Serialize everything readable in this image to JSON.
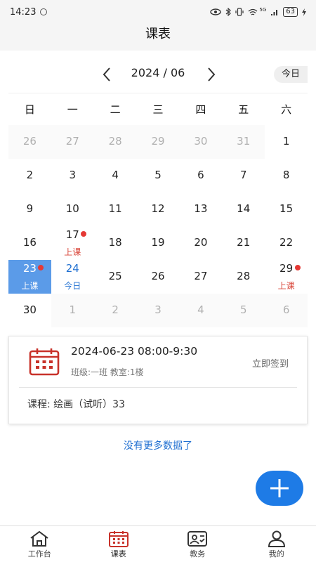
{
  "status_bar": {
    "time": "14:23",
    "network": "5G",
    "battery": "63"
  },
  "header": {
    "title": "课表"
  },
  "calendar": {
    "month_label": "2024 / 06",
    "today_button": "今日",
    "weekdays": [
      "日",
      "一",
      "二",
      "三",
      "四",
      "五",
      "六"
    ],
    "weeks": [
      [
        {
          "d": "26",
          "other": true
        },
        {
          "d": "27",
          "other": true
        },
        {
          "d": "28",
          "other": true
        },
        {
          "d": "29",
          "other": true
        },
        {
          "d": "30",
          "other": true
        },
        {
          "d": "31",
          "other": true
        },
        {
          "d": "1"
        }
      ],
      [
        {
          "d": "2"
        },
        {
          "d": "3"
        },
        {
          "d": "4"
        },
        {
          "d": "5"
        },
        {
          "d": "6"
        },
        {
          "d": "7"
        },
        {
          "d": "8"
        }
      ],
      [
        {
          "d": "9"
        },
        {
          "d": "10"
        },
        {
          "d": "11"
        },
        {
          "d": "12"
        },
        {
          "d": "13"
        },
        {
          "d": "14"
        },
        {
          "d": "15"
        }
      ],
      [
        {
          "d": "16"
        },
        {
          "d": "17",
          "tag": "上课",
          "dot": true
        },
        {
          "d": "18"
        },
        {
          "d": "19"
        },
        {
          "d": "20"
        },
        {
          "d": "21"
        },
        {
          "d": "22"
        }
      ],
      [
        {
          "d": "23",
          "tag": "上课",
          "dot": true,
          "selected": true
        },
        {
          "d": "24",
          "tag": "今日",
          "today": true
        },
        {
          "d": "25"
        },
        {
          "d": "26"
        },
        {
          "d": "27"
        },
        {
          "d": "28"
        },
        {
          "d": "29",
          "tag": "上课",
          "dot": true
        }
      ],
      [
        {
          "d": "30"
        },
        {
          "d": "1",
          "other": true
        },
        {
          "d": "2",
          "other": true
        },
        {
          "d": "3",
          "other": true
        },
        {
          "d": "4",
          "other": true
        },
        {
          "d": "5",
          "other": true
        },
        {
          "d": "6",
          "other": true
        }
      ]
    ]
  },
  "lesson_card": {
    "datetime": "2024-06-23 08:00-9:30",
    "meta": "班级:一班 教室:1楼",
    "checkin_label": "立即签到",
    "course": "课程: 绘画（试听）33"
  },
  "no_more_text": "没有更多数据了",
  "tabs": [
    {
      "label": "工作台",
      "icon": "home-icon"
    },
    {
      "label": "课表",
      "icon": "calendar-icon"
    },
    {
      "label": "教务",
      "icon": "academic-affairs-icon"
    },
    {
      "label": "我的",
      "icon": "profile-icon"
    }
  ],
  "colors": {
    "accent": "#1e7be6",
    "selected_day": "#5b9be8",
    "class_tag": "#d9463a",
    "calendar_icon": "#c8322a"
  }
}
